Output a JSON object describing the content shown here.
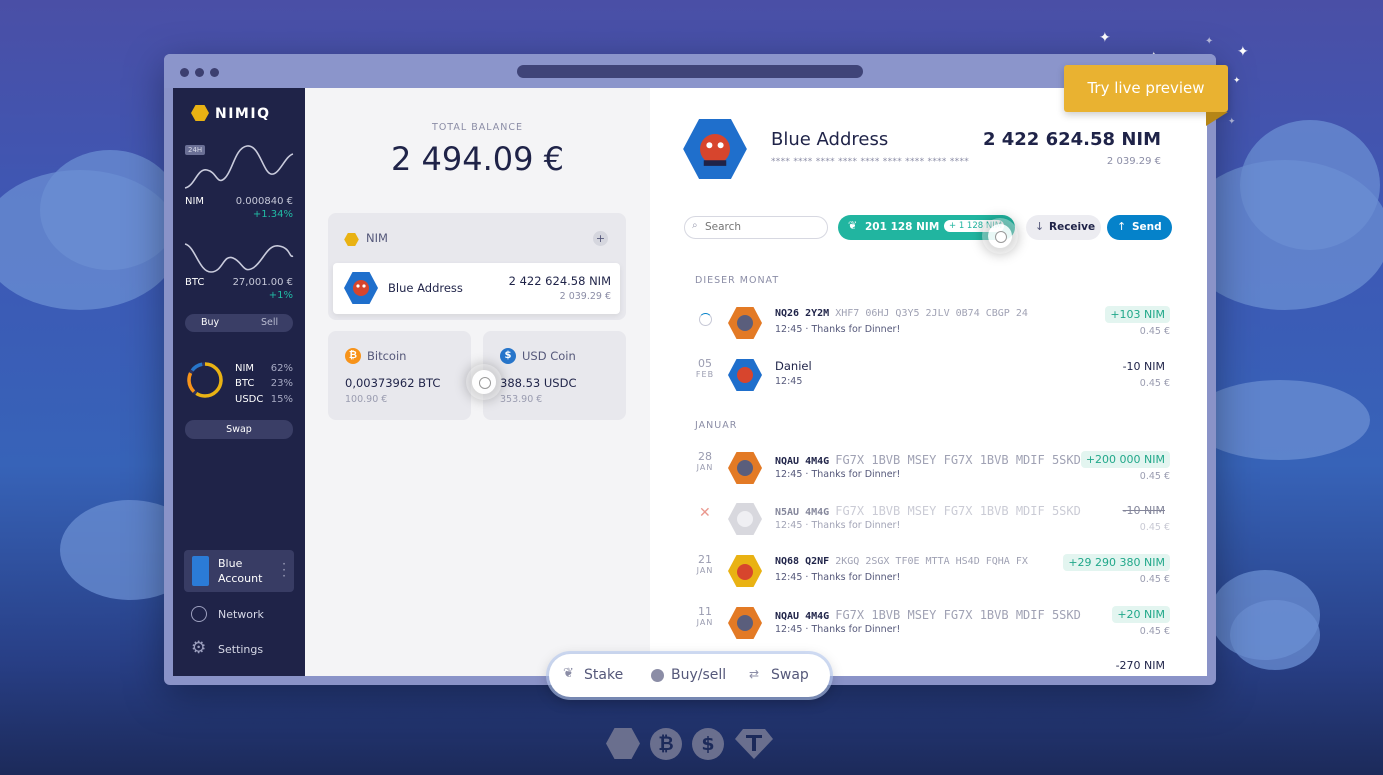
{
  "colors": {
    "accent": "#e9b213",
    "nim_gold": "#e9b213",
    "blue": "#0582ca",
    "green": "#21bca5",
    "dark": "#1f2348",
    "try_preview": "#e9b231"
  },
  "promo": {
    "try_live_preview": "Try live preview"
  },
  "sidebar": {
    "brand": "NIMIQ",
    "badge_24h": "24H",
    "nim": {
      "label": "NIM",
      "price": "0.000840 €",
      "change": "+1.34%"
    },
    "btc": {
      "label": "BTC",
      "price": "27,001.00 €",
      "change": "+1%"
    },
    "buy": "Buy",
    "sell": "Sell",
    "allocation": [
      {
        "label": "NIM",
        "pct": "62%"
      },
      {
        "label": "BTC",
        "pct": "23%"
      },
      {
        "label": "USDC",
        "pct": "15%"
      }
    ],
    "allocation_fractions": [
      0.62,
      0.23,
      0.15
    ],
    "swap": "Swap",
    "account": {
      "line1": "Blue",
      "line2": "Account"
    },
    "network": "Network",
    "settings": "Settings"
  },
  "balance": {
    "label": "TOTAL BALANCE",
    "value": "2 494.09 €"
  },
  "nim_section": {
    "title": "NIM",
    "add": "+"
  },
  "address_card": {
    "name": "Blue Address",
    "nim": "2 422 624.58 NIM",
    "fiat": "2 039.29 €"
  },
  "bitcoin": {
    "title": "Bitcoin",
    "amount": "0,00373962 BTC",
    "fiat": "100.90 €"
  },
  "usdc": {
    "title": "USD Coin",
    "amount": "388.53 USDC",
    "fiat": "353.90 €"
  },
  "detail": {
    "name": "Blue Address",
    "nim": "2 422 624.58 NIM",
    "fiat": "2 039.29 €",
    "address_masked": "**** **** **** **** **** **** **** **** ****",
    "search_placeholder": "Search",
    "staked": "201 128 NIM",
    "staked_reward": "+ 1 128 NIM",
    "receive": "Receive",
    "send": "Send"
  },
  "sections": {
    "this_month": "DIESER MONAT",
    "january": "JANUAR"
  },
  "transactions": [
    {
      "day": "",
      "month": "",
      "addr_bold": "NQ26 2Y2M",
      "addr_rest": "XHF7 06HJ Q3Y5 2JLV 0B74 CBGP 24",
      "time": "12:45",
      "sep": "·",
      "message": "Thanks for Dinner!",
      "amount": "+103 NIM",
      "fiat": "0.45 €"
    },
    {
      "day": "05",
      "month": "FEB",
      "addr_bold": "Daniel",
      "addr_rest": "",
      "time": "12:45",
      "sep": "",
      "message": "",
      "amount": "-10 NIM",
      "fiat": "0.45 €"
    },
    {
      "day": "28",
      "month": "JAN",
      "addr_bold": "NQAU 4M4G",
      "addr_rest": "FG7X 1BVB MSEY FG7X 1BVB MDIF 5SKD",
      "time": "12:45",
      "sep": "·",
      "message": "Thanks for Dinner!",
      "amount": "+200 000 NIM",
      "fiat": "0.45 €"
    },
    {
      "day": "",
      "month": "",
      "addr_bold": "N5AU 4M4G",
      "addr_rest": "FG7X 1BVB MSEY FG7X 1BVB MDIF 5SKD",
      "time": "12:45",
      "sep": "·",
      "message": "Thanks for Dinner!",
      "amount": "-10 NIM",
      "fiat": "0.45 €"
    },
    {
      "day": "21",
      "month": "JAN",
      "addr_bold": "NQ68 Q2NF",
      "addr_rest": "2KGQ 2SGX TF0E MTTA HS4D FQHA FX",
      "time": "12:45",
      "sep": "·",
      "message": "Thanks for Dinner!",
      "amount": "+29 290 380 NIM",
      "fiat": "0.45 €"
    },
    {
      "day": "11",
      "month": "JAN",
      "addr_bold": "NQAU 4M4G",
      "addr_rest": "FG7X 1BVB MSEY FG7X 1BVB MDIF 5SKD",
      "time": "12:45",
      "sep": "·",
      "message": "Thanks for Dinner!",
      "amount": "+20 NIM",
      "fiat": "0.45 €"
    },
    {
      "day": "",
      "month": "",
      "addr_bold": "",
      "addr_rest": "",
      "time": "",
      "sep": "",
      "message": "",
      "amount": "-270 NIM",
      "fiat": ""
    }
  ],
  "bottom_bar": {
    "stake": "Stake",
    "buysell": "Buy/sell",
    "swap": "Swap"
  }
}
